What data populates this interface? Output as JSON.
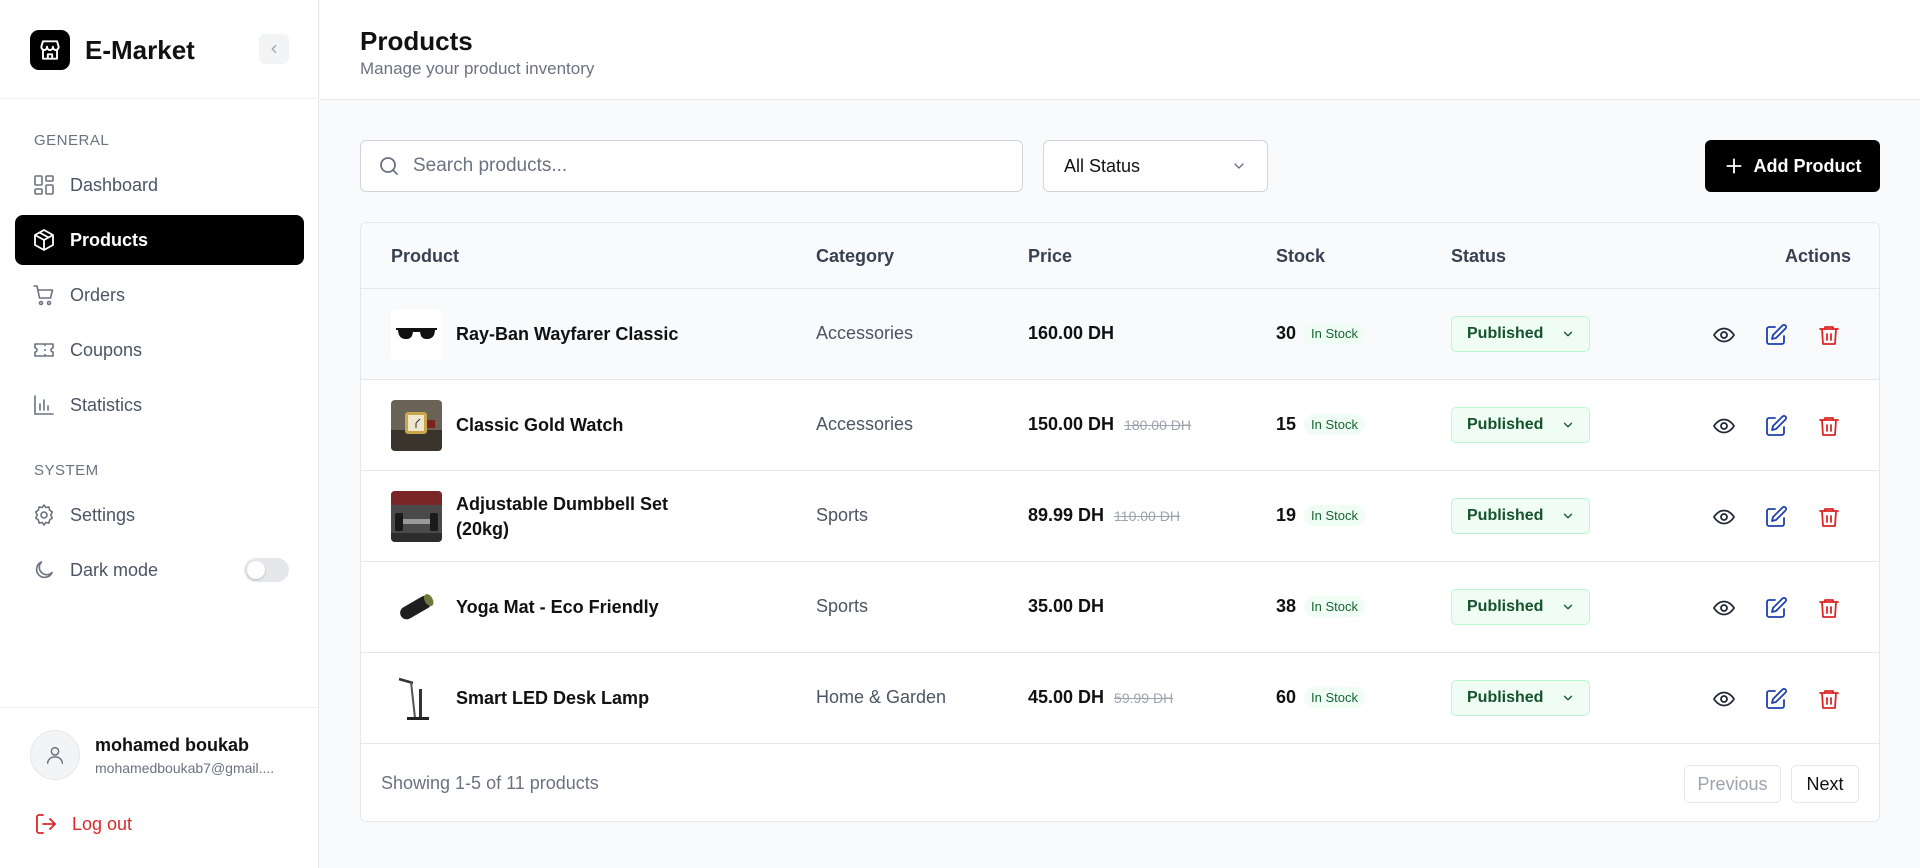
{
  "brand": {
    "name": "E-Market"
  },
  "sidebar": {
    "general_label": "GENERAL",
    "system_label": "SYSTEM",
    "items": [
      {
        "label": "Dashboard",
        "icon": "dashboard-icon"
      },
      {
        "label": "Products",
        "icon": "box-icon",
        "active": true
      },
      {
        "label": "Orders",
        "icon": "cart-icon"
      },
      {
        "label": "Coupons",
        "icon": "ticket-icon"
      },
      {
        "label": "Statistics",
        "icon": "bar-chart-icon"
      }
    ],
    "system_items": [
      {
        "label": "Settings",
        "icon": "gear-icon"
      },
      {
        "label": "Dark mode",
        "icon": "moon-icon",
        "toggle": false
      }
    ]
  },
  "user": {
    "name": "mohamed boukab",
    "email": "mohamedboukab7@gmail...."
  },
  "logout_label": "Log out",
  "header": {
    "title": "Products",
    "subtitle": "Manage your product inventory"
  },
  "toolbar": {
    "search_placeholder": "Search products...",
    "status_filter": "All Status",
    "add_label": "Add Product"
  },
  "table": {
    "columns": [
      "Product",
      "Category",
      "Price",
      "Stock",
      "Status",
      "Actions"
    ],
    "rows": [
      {
        "name": "Ray-Ban Wayfarer Classic",
        "category": "Accessories",
        "price": "160.00 DH",
        "old_price": "",
        "stock": "30",
        "stock_badge": "In Stock",
        "status": "Published"
      },
      {
        "name": "Classic Gold Watch",
        "category": "Accessories",
        "price": "150.00 DH",
        "old_price": "180.00 DH",
        "stock": "15",
        "stock_badge": "In Stock",
        "status": "Published"
      },
      {
        "name": "Adjustable Dumbbell Set (20kg)",
        "category": "Sports",
        "price": "89.99 DH",
        "old_price": "110.00 DH",
        "stock": "19",
        "stock_badge": "In Stock",
        "status": "Published"
      },
      {
        "name": "Yoga Mat - Eco Friendly",
        "category": "Sports",
        "price": "35.00 DH",
        "old_price": "",
        "stock": "38",
        "stock_badge": "In Stock",
        "status": "Published"
      },
      {
        "name": "Smart LED Desk Lamp",
        "category": "Home & Garden",
        "price": "45.00 DH",
        "old_price": "59.99 DH",
        "stock": "60",
        "stock_badge": "In Stock",
        "status": "Published"
      }
    ]
  },
  "pagination": {
    "summary": "Showing 1-5 of 11 products",
    "previous": "Previous",
    "next": "Next"
  },
  "colors": {
    "accent": "#000000",
    "success_bg": "#f0fdf4",
    "success_text": "#166534",
    "edit_icon": "#1e40af",
    "delete_icon": "#dc2626"
  }
}
